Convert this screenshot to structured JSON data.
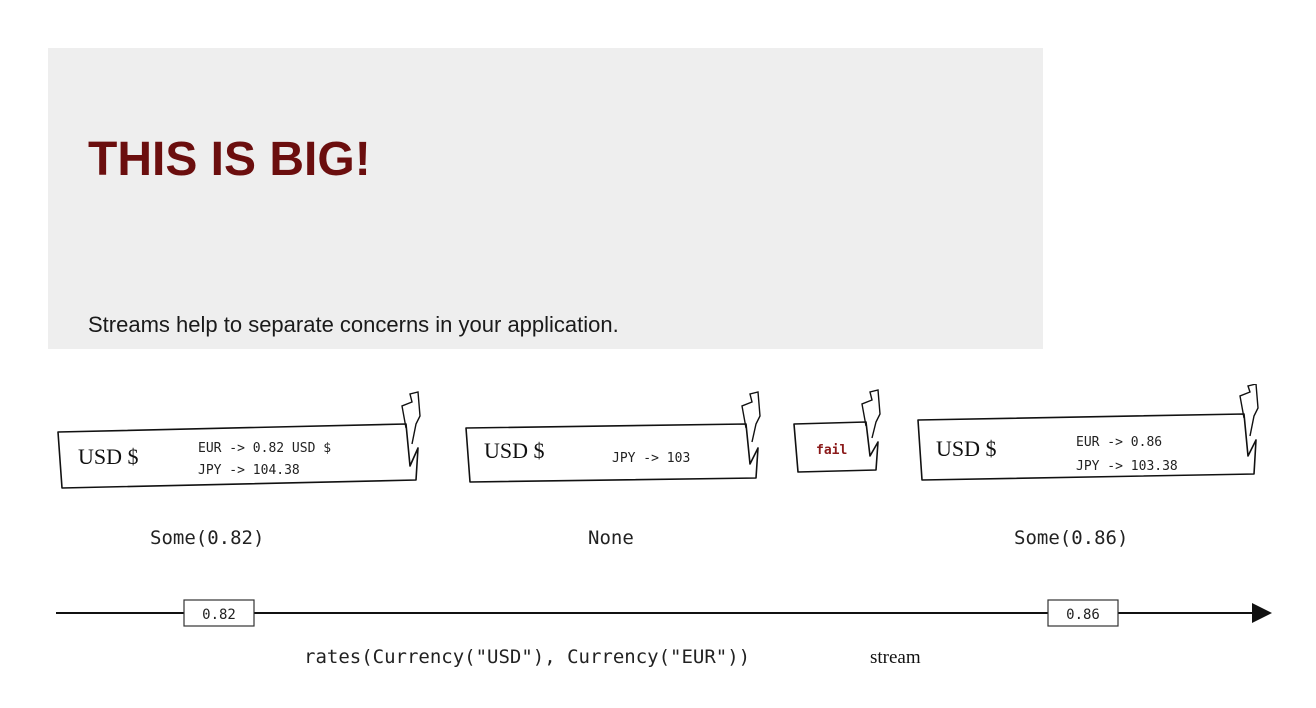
{
  "callout": {
    "title": "THIS IS BIG!",
    "text": "Streams help to separate concerns in your application."
  },
  "diagram": {
    "boxes": [
      {
        "currency": "USD $",
        "lines": [
          "EUR -> 0.82 USD $",
          "JPY -> 104.38"
        ],
        "result": "Some(0.82)"
      },
      {
        "currency": "USD $",
        "lines": [
          "JPY -> 103"
        ],
        "result": "None"
      },
      {
        "currency": "",
        "lines": [
          "fail"
        ],
        "result": ""
      },
      {
        "currency": "USD $",
        "lines": [
          "EUR -> 0.86",
          "JPY -> 103.38"
        ],
        "result": "Some(0.86)"
      }
    ],
    "stream_values": [
      "0.82",
      "0.86"
    ],
    "stream_label_code": "rates(Currency(\"USD\"), Currency(\"EUR\"))",
    "stream_label_word": "stream",
    "colors": {
      "title": "#6b0e0e",
      "fail": "#8b1a1a",
      "callout_bg": "#eeeeee"
    }
  }
}
